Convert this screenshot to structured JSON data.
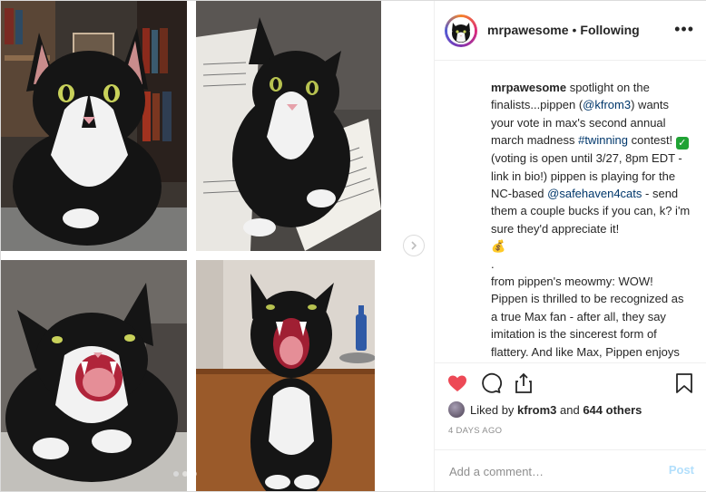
{
  "post": {
    "author": "mrpawesome",
    "separator": "•",
    "follow_state": "Following",
    "more_label": "•••"
  },
  "caption": {
    "author": "mrpawesome",
    "part1": " spotlight on the finalists...pippen (",
    "mention1": "@kfrom3",
    "part2": ") wants your vote in max's second annual march madness ",
    "hashtag": "#twinning",
    "part3": " contest! ",
    "check_emoji": "✓",
    "part4": " (voting is open until 3/27, 8pm EDT - link in bio!) pippen is playing for the NC-based ",
    "mention2": "@safehaven4cats",
    "part5": " - send them a couple bucks if you can, k? i'm sure they'd appreciate it! ",
    "bag_emoji": "💰",
    "dot_line": ".",
    "part6": "from pippen's meowmy: WOW! Pippen is thrilled to be recognized as a true Max fan - after all, they say imitation is the sincerest form of flattery. And like Max, Pippen enjoys intense staring, yawns that open the portal to another dimension, homemade biscuits, and of course, doing one's civic duty by"
  },
  "likes": {
    "prefix": "Liked by ",
    "user": "kfrom3",
    "middle": " and ",
    "count": "644 others"
  },
  "timestamp": "4 DAYS AGO",
  "comment": {
    "placeholder": "Add a comment…",
    "post_label": "Post"
  },
  "carousel": {
    "total": 3,
    "active_index": 1
  },
  "colors": {
    "heart": "#ed4956",
    "link": "#00376b",
    "post_disabled": "#b2dffc"
  }
}
